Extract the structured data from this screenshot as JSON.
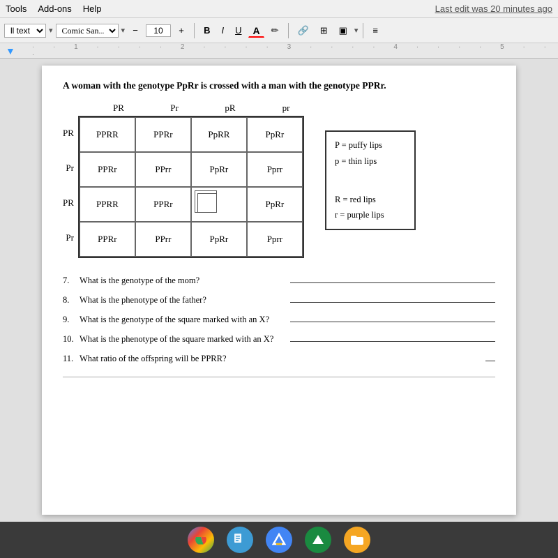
{
  "menubar": {
    "tools": "Tools",
    "addons": "Add-ons",
    "help": "Help",
    "last_edit": "Last edit was 20 minutes ago"
  },
  "toolbar": {
    "paragraph_label": "ll text",
    "font_name": "Comic San...",
    "font_size": "10",
    "bold": "B",
    "italic": "I",
    "underline": "U",
    "text_color": "A",
    "minus": "−",
    "plus": "+"
  },
  "intro": {
    "text": "A woman with the genotype PpRr is crossed with a man with the genotype PPRr."
  },
  "punnett": {
    "col_headers": [
      "PR",
      "Pr",
      "pR",
      "pr"
    ],
    "rows": [
      {
        "label": "PR",
        "cells": [
          "PPRR",
          "PPRr",
          "PpRR",
          "PpRr"
        ]
      },
      {
        "label": "Pr",
        "cells": [
          "PPRr",
          "PPrr",
          "PpRr",
          "Pprr"
        ]
      },
      {
        "label": "PR",
        "cells": [
          "PPRR",
          "PPRr",
          "",
          "PpRr"
        ]
      },
      {
        "label": "Pr",
        "cells": [
          "PPRr",
          "PPrr",
          "PpRr",
          "Pprr"
        ]
      }
    ],
    "marked_cell": {
      "row": 2,
      "col": 2
    }
  },
  "legend": {
    "lines": [
      "P = puffy lips",
      "p = thin lips",
      "",
      "R = red lips",
      "r = purple lips"
    ]
  },
  "questions": [
    {
      "num": "7.",
      "text": "What is the genotype of the mom?",
      "line_type": "long"
    },
    {
      "num": "8.",
      "text": "What is the phenotype of the father?",
      "line_type": "long"
    },
    {
      "num": "9.",
      "text": "What is the genotype of the square marked with an X?",
      "line_type": "long"
    },
    {
      "num": "10.",
      "text": "What is the phenotype of the square marked with an X?",
      "line_type": "long"
    },
    {
      "num": "11.",
      "text": "What ratio of the offspring will be PPRR?",
      "line_type": "short"
    }
  ],
  "taskbar": {
    "icons": [
      "chrome",
      "files",
      "drive",
      "triangle",
      "folder"
    ]
  }
}
